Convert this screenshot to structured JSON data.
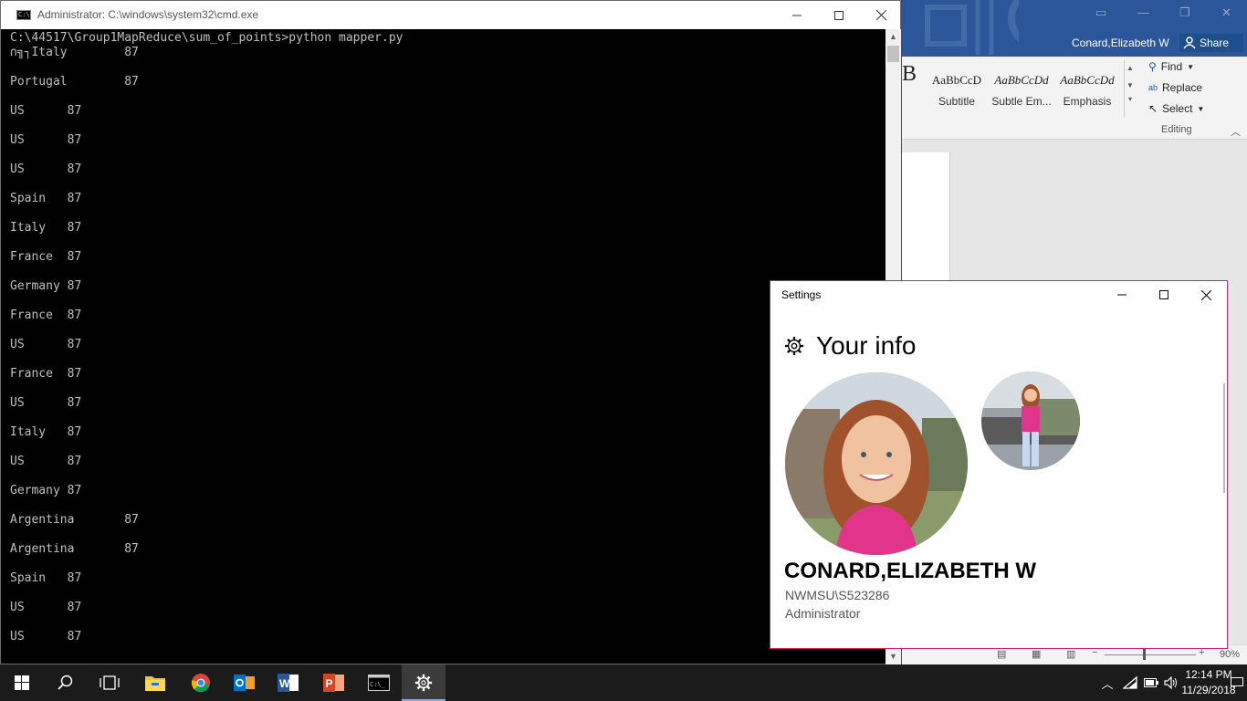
{
  "word": {
    "user": "Conard,Elizabeth W",
    "share": "Share",
    "ribbon_partial_glyph": "B",
    "styles": [
      {
        "sample": "AaBbCcD",
        "name": "Subtitle",
        "italic": false
      },
      {
        "sample": "AaBbCcDd",
        "name": "Subtle Em...",
        "italic": true
      },
      {
        "sample": "AaBbCcDd",
        "name": "Emphasis",
        "italic": true
      }
    ],
    "editing": {
      "find": "Find",
      "replace": "Replace",
      "select": "Select",
      "group_label": "Editing"
    },
    "zoom": "90%"
  },
  "cmd": {
    "title": "Administrator: C:\\windows\\system32\\cmd.exe",
    "prompt_line": "C:\\44517\\Group1MapReduce\\sum_of_points>python mapper.py",
    "lines": [
      "∩╗┐Italy\t87",
      "Portugal\t87",
      "US\t87",
      "US\t87",
      "US\t87",
      "Spain\t87",
      "Italy\t87",
      "France\t87",
      "Germany\t87",
      "France\t87",
      "US\t87",
      "France\t87",
      "US\t87",
      "Italy\t87",
      "US\t87",
      "Germany\t87",
      "Argentina\t87",
      "Argentina\t87",
      "Spain\t87",
      "US\t87",
      "US\t87"
    ]
  },
  "settings": {
    "title": "Settings",
    "heading": "Your info",
    "user_name": "CONARD,ELIZABETH W",
    "account": "NWMSU\\S523286",
    "role": "Administrator",
    "accent": "#d61f6f"
  },
  "taskbar": {
    "apps": [
      "start-icon",
      "search-icon",
      "task-view-icon",
      "file-explorer-icon",
      "chrome-icon",
      "outlook-icon",
      "word-icon",
      "powerpoint-icon",
      "cmd-icon",
      "settings-icon"
    ],
    "time": "12:14 PM",
    "date": "11/29/2018"
  }
}
